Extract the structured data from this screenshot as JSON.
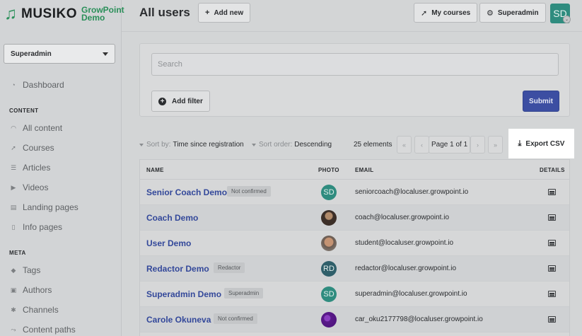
{
  "app": {
    "logo_name": "MUSIKO",
    "logo_sub_1": "GrowPoint",
    "logo_sub_2": "Demo"
  },
  "sidebar": {
    "role_select": "Superadmin",
    "dashboard": "Dashboard",
    "content_section": "CONTENT",
    "content_items": [
      "All content",
      "Courses",
      "Articles",
      "Videos",
      "Landing pages",
      "Info pages"
    ],
    "meta_section": "META",
    "meta_items": [
      "Tags",
      "Authors",
      "Channels",
      "Content paths"
    ]
  },
  "header": {
    "title": "All users",
    "add_new": "Add new",
    "my_courses": "My courses",
    "superadmin": "Superadmin",
    "avatar_initials": "SD"
  },
  "filters": {
    "search_placeholder": "Search",
    "add_filter": "Add filter",
    "submit": "Submit"
  },
  "toolbar": {
    "sort_by_label": "Sort by:",
    "sort_by_value": "Time since registration",
    "sort_order_label": "Sort order:",
    "sort_order_value": "Descending",
    "count": "25 elements",
    "page_info": "Page 1 of 1",
    "export": "Export CSV"
  },
  "table": {
    "columns": {
      "name": "NAME",
      "photo": "PHOTO",
      "email": "EMAIL",
      "details": "DETAILS"
    },
    "rows": [
      {
        "name": "Senior Coach Demo",
        "badge": "Not confirmed",
        "photo": "SD",
        "email": "seniorcoach@localuser.growpoint.io"
      },
      {
        "name": "Coach Demo",
        "badge": "",
        "photo": "",
        "email": "coach@localuser.growpoint.io"
      },
      {
        "name": "User Demo",
        "badge": "",
        "photo": "",
        "email": "student@localuser.growpoint.io"
      },
      {
        "name": "Redactor Demo",
        "badge": "Redactor",
        "photo": "RD",
        "email": "redactor@localuser.growpoint.io"
      },
      {
        "name": "Superadmin Demo",
        "badge": "Superadmin",
        "photo": "SD",
        "email": "superadmin@localuser.growpoint.io"
      },
      {
        "name": "Carole Okuneva",
        "badge": "Not confirmed",
        "photo": "",
        "email": "car_oku2177798@localuser.growpoint.io"
      }
    ]
  },
  "colors": {
    "accent": "#3c4ea2",
    "link": "#33489a",
    "brand": "#2a8f59",
    "avatar_teal": "#2f8c7f"
  }
}
